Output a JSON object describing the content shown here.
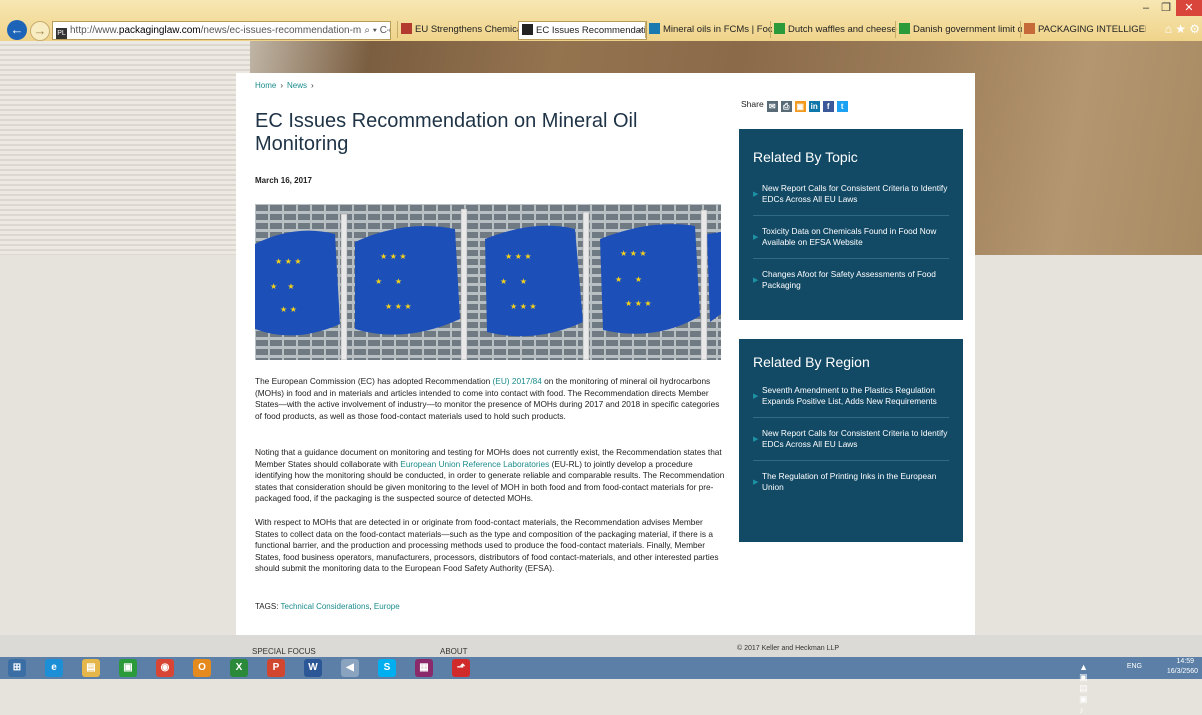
{
  "browser": {
    "url_prefix": "http://www.",
    "url_domain": "packaginglaw.com",
    "url_path": "/news/ec-issues-recommendation-mineral-oil-monitori",
    "url_controls": "⌕ ▾ C",
    "tabs": [
      {
        "label": "EU Strengthens Chemical Safet...",
        "color": "#b23a2f",
        "active": false
      },
      {
        "label": "EC Issues Recommendation...",
        "color": "#222222",
        "active": true
      },
      {
        "label": "Mineral oils in FCMs | Food Pa...",
        "color": "#1a7ab0",
        "active": false
      },
      {
        "label": "Dutch waffles and cheese bisc...",
        "color": "#2a9a3a",
        "active": false
      },
      {
        "label": "Danish government limit on fl...",
        "color": "#2a9a3a",
        "active": false
      },
      {
        "label": "PACKAGING INTELLIGENCE U...",
        "color": "#c76a3a",
        "active": false
      }
    ],
    "tab_close": "×",
    "win_minimize": "–",
    "win_restore": "❐",
    "win_close": "✕",
    "toolbar_icons": [
      "⌂",
      "★",
      "⚙"
    ]
  },
  "breadcrumb": {
    "home": "Home",
    "news": "News",
    "sep": "›"
  },
  "article": {
    "title": "EC Issues Recommendation on Mineral Oil Monitoring",
    "date": "March 16, 2017",
    "p1_a": "The European Commission (EC) has adopted Recommendation ",
    "p1_link": "(EU) 2017/84",
    "p1_b": " on the monitoring of mineral oil hydrocarbons (MOHs) in food and in materials and articles intended to come into contact with food. The Recommendation directs Member States—with the active involvement of industry—to monitor the presence of MOHs during 2017 and 2018 in specific categories of food products, as well as those food-contact materials used to hold such products.",
    "p2_a": "Noting that a guidance document on monitoring and testing for MOHs does not currently exist, the Recommendation states that Member States should collaborate with ",
    "p2_link": "European Union Reference Laboratories",
    "p2_b": " (EU-RL) to jointly develop a procedure identifying how the monitoring should be conducted, in order to generate reliable and comparable results. The Recommendation states that consideration should be given monitoring to the level of MOH in both food and from food-contact materials for pre-packaged food, if the packaging is the suspected source of detected MOHs.",
    "p3": "With respect to MOHs that are detected in or originate from food-contact materials, the Recommendation advises Member States to collect data on the food-contact materials—such as the type and composition of the packaging material, if there is a functional barrier, and the production and processing methods used to produce the food-contact materials. Finally, Member States, food business operators, manufacturers, processors, distributors of food contact-materials, and other interested parties should submit the monitoring data to the European Food Safety Authority (EFSA).",
    "tags_label": "TAGS:",
    "tags": [
      "Technical Considerations",
      "Europe"
    ],
    "tag_sep": ","
  },
  "share": {
    "label": "Share",
    "icons": [
      {
        "name": "email",
        "glyph": "✉",
        "color": "#5a6b78"
      },
      {
        "name": "print",
        "glyph": "⎙",
        "color": "#5a6b78"
      },
      {
        "name": "feed",
        "glyph": "▣",
        "color": "#f39a1e"
      },
      {
        "name": "linkedin",
        "glyph": "in",
        "color": "#0e76a8"
      },
      {
        "name": "facebook",
        "glyph": "f",
        "color": "#3b5998"
      },
      {
        "name": "twitter",
        "glyph": "t",
        "color": "#1da1f2"
      }
    ]
  },
  "related_topic": {
    "title": "Related By Topic",
    "items": [
      "New Report Calls for Consistent Criteria to Identify EDCs Across All EU Laws",
      "Toxicity Data on Chemicals Found in Food Now Available on EFSA Website",
      "Changes Afoot for Safety Assessments of Food Packaging"
    ]
  },
  "related_region": {
    "title": "Related By Region",
    "items": [
      "Seventh Amendment to the Plastics Regulation Expands Positive List, Adds New Requirements",
      "New Report Calls for Consistent Criteria to Identify EDCs Across All EU Laws",
      "The Regulation of Printing Inks in the European Union"
    ]
  },
  "footer": {
    "special_focus": "SPECIAL FOCUS",
    "about": "ABOUT",
    "copyright": "© 2017 Keller and Heckman LLP"
  },
  "taskbar": {
    "apps": [
      {
        "name": "start",
        "glyph": "⊞",
        "color": "#3b6ea5"
      },
      {
        "name": "ie",
        "glyph": "e",
        "color": "#1d8fd6"
      },
      {
        "name": "explorer",
        "glyph": "▤",
        "color": "#e5b64a"
      },
      {
        "name": "store",
        "glyph": "▣",
        "color": "#2a9a3a"
      },
      {
        "name": "chrome",
        "glyph": "◉",
        "color": "#d94535"
      },
      {
        "name": "outlook",
        "glyph": "O",
        "color": "#e58b1e"
      },
      {
        "name": "excel",
        "glyph": "X",
        "color": "#2a8a3a"
      },
      {
        "name": "powerpoint",
        "glyph": "P",
        "color": "#d2452f"
      },
      {
        "name": "word",
        "glyph": "W",
        "color": "#2b5797"
      },
      {
        "name": "media",
        "glyph": "◀",
        "color": "#8aa3bf"
      },
      {
        "name": "skype",
        "glyph": "S",
        "color": "#00aff0"
      },
      {
        "name": "winrar",
        "glyph": "▦",
        "color": "#8a2a6a"
      },
      {
        "name": "acrobat",
        "glyph": "⬏",
        "color": "#d12a2a"
      }
    ],
    "lang": "ENG",
    "time": "14:59",
    "date": "16/3/2560"
  }
}
